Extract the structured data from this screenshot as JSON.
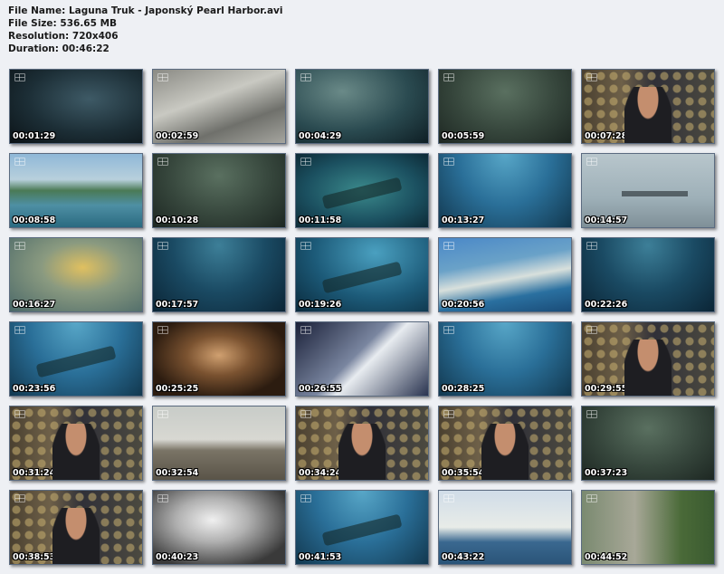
{
  "header": {
    "file_name": "File Name: Laguna Truk - Japonský Pearl Harbor.avi",
    "file_size": "File Size: 536.65 MB",
    "resolution": "Resolution: 720x406",
    "duration": "Duration: 00:46:22"
  },
  "thumbnails": [
    {
      "time": "00:01:29",
      "scene": "s-dark"
    },
    {
      "time": "00:02:59",
      "scene": "s-bw"
    },
    {
      "time": "00:04:29",
      "scene": "s-wheel"
    },
    {
      "time": "00:05:59",
      "scene": "s-murky"
    },
    {
      "time": "00:07:28",
      "scene": "s-studio presenter studio-bg"
    },
    {
      "time": "00:08:58",
      "scene": "s-island"
    },
    {
      "time": "00:10:28",
      "scene": "s-murky"
    },
    {
      "time": "00:11:58",
      "scene": "s-teal wreck"
    },
    {
      "time": "00:13:27",
      "scene": "s-blue"
    },
    {
      "time": "00:14:57",
      "scene": "s-haze ship"
    },
    {
      "time": "00:16:27",
      "scene": "s-yellow"
    },
    {
      "time": "00:17:57",
      "scene": "s-deep"
    },
    {
      "time": "00:19:26",
      "scene": "s-ring wreck"
    },
    {
      "time": "00:20:56",
      "scene": "s-reef"
    },
    {
      "time": "00:22:26",
      "scene": "s-deep"
    },
    {
      "time": "00:23:56",
      "scene": "s-blue wreck"
    },
    {
      "time": "00:25:25",
      "scene": "s-tunnel"
    },
    {
      "time": "00:26:55",
      "scene": "s-space"
    },
    {
      "time": "00:28:25",
      "scene": "s-blue"
    },
    {
      "time": "00:29:55",
      "scene": "s-studio presenter studio-bg"
    },
    {
      "time": "00:31:24",
      "scene": "s-studio presenter studio-bg"
    },
    {
      "time": "00:32:54",
      "scene": "s-deck"
    },
    {
      "time": "00:34:24",
      "scene": "s-studio presenter studio-bg"
    },
    {
      "time": "00:35:54",
      "scene": "s-studio presenter studio-bg"
    },
    {
      "time": "00:37:23",
      "scene": "s-murky"
    },
    {
      "time": "00:38:53",
      "scene": "s-studio presenter studio-bg"
    },
    {
      "time": "00:40:23",
      "scene": "s-smoke"
    },
    {
      "time": "00:41:53",
      "scene": "s-blue wreck"
    },
    {
      "time": "00:43:22",
      "scene": "s-photo"
    },
    {
      "time": "00:44:52",
      "scene": "s-ruins"
    }
  ]
}
